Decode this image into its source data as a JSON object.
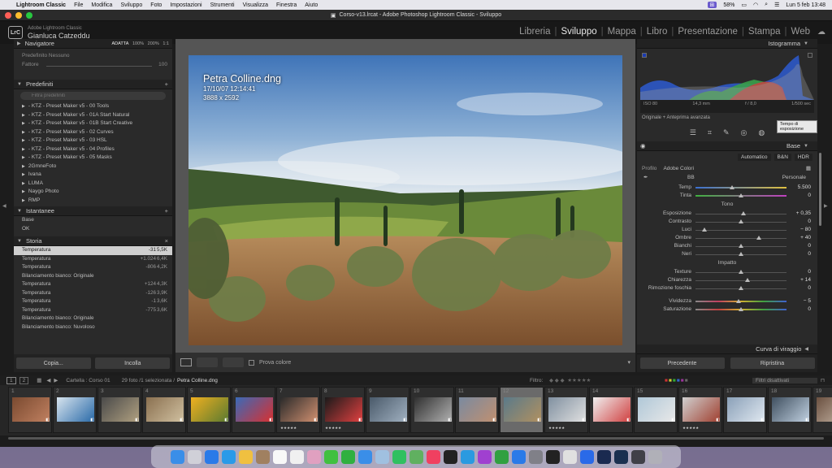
{
  "macos": {
    "menu": [
      "Lightroom Classic",
      "File",
      "Modifica",
      "Sviluppo",
      "Foto",
      "Impostazioni",
      "Strumenti",
      "Visualizza",
      "Finestra",
      "Aiuto"
    ],
    "battery": "58%",
    "clock": "Lun 5 feb  13:48"
  },
  "window": {
    "title": "Corso-v13.lrcat - Adobe Photoshop Lightroom Classic - Sviluppo"
  },
  "identity": {
    "badge": "LrC",
    "product": "Adobe Lightroom Classic",
    "user": "Gianluca Catzeddu"
  },
  "modules": [
    "Libreria",
    "Sviluppo",
    "Mappa",
    "Libro",
    "Presentazione",
    "Stampa",
    "Web"
  ],
  "left": {
    "navigator": {
      "title": "Navigatore",
      "zoom": [
        "ADATTA",
        "100%",
        "200%",
        "1:1"
      ]
    },
    "preset_preview": {
      "label": "Predefinito Nessuno",
      "amount_label": "Fattore",
      "amount": "100"
    },
    "presets": {
      "title": "Predefiniti",
      "search_placeholder": "Filtra predefiniti",
      "items": [
        "- KTZ - Preset Maker v5 - 00 Tools",
        "- KTZ - Preset Maker v5 - 01A Start Natural",
        "- KTZ - Preset Maker v5 - 01B Start Creative",
        "- KTZ - Preset Maker v5 - 02 Curves",
        "- KTZ - Preset Maker v5 - 03 HSL",
        "- KTZ - Preset Maker v5 - 04 Profiles",
        "- KTZ - Preset Maker v5 - 05 Masks",
        "2GmneFoto",
        "Ivana",
        "LUMA",
        "Naygo Photo",
        "RMP"
      ]
    },
    "snapshots": {
      "title": "Istantanee",
      "items": [
        "Base",
        "OK"
      ]
    },
    "history": {
      "title": "Storia",
      "items": [
        {
          "label": "Temperatura",
          "a": "-31",
          "b": "5,5K"
        },
        {
          "label": "Temperatura",
          "a": "+1.024",
          "b": "6,4K"
        },
        {
          "label": "Temperatura",
          "a": "-806",
          "b": "4,2K"
        },
        {
          "label": "Bilanciamento bianco: Originale",
          "a": "",
          "b": ""
        },
        {
          "label": "Temperatura",
          "a": "+124",
          "b": "4,3K"
        },
        {
          "label": "Temperatura",
          "a": "-126",
          "b": "3,9K"
        },
        {
          "label": "Temperatura",
          "a": "-1",
          "b": "3,6K"
        },
        {
          "label": "Temperatura",
          "a": "-775",
          "b": "3,6K"
        },
        {
          "label": "Bilanciamento bianco: Originale",
          "a": "",
          "b": ""
        },
        {
          "label": "Bilanciamento bianco: Nuvoloso",
          "a": "",
          "b": ""
        }
      ]
    },
    "buttons": {
      "copy": "Copia...",
      "paste": "Incolla"
    }
  },
  "photo": {
    "filename": "Petra Colline.dng",
    "datetime": "17/10/07 12:14:41",
    "dims": "3888 x 2592"
  },
  "toolbar": {
    "soft_proof": "Prova colore"
  },
  "right": {
    "histogram": {
      "title": "Istogramma",
      "iso": "ISO 80",
      "focal": "14,3 mm",
      "aperture": "f / 8,0",
      "shutter": "1/500 sec",
      "original_label": "Originale + Anteprima avanzata",
      "tooltip": "Tempo di esposizione"
    },
    "basic": {
      "title": "Base",
      "modes": [
        "Automatico",
        "B&N",
        "HDR"
      ],
      "profile_label": "Profilo",
      "profile_value": "Adobe Colori",
      "wb_label": "BB",
      "wb_value": "Personale",
      "temp": {
        "label": "Temp",
        "value": "5.500",
        "pos": 0.4
      },
      "tint": {
        "label": "Tinta",
        "value": "0",
        "pos": 0.5
      },
      "tone_title": "Tono",
      "tone": [
        {
          "label": "Esposizione",
          "value": "+ 0,35",
          "pos": 0.53
        },
        {
          "label": "Contrasto",
          "value": "0",
          "pos": 0.5
        },
        {
          "label": "Luci",
          "value": "− 80",
          "pos": 0.1
        },
        {
          "label": "Ombre",
          "value": "+ 40",
          "pos": 0.7
        },
        {
          "label": "Bianchi",
          "value": "0",
          "pos": 0.5
        },
        {
          "label": "Neri",
          "value": "0",
          "pos": 0.5
        }
      ],
      "presence_title": "Impatto",
      "presence": [
        {
          "label": "Texture",
          "value": "0",
          "pos": 0.5
        },
        {
          "label": "Chiarezza",
          "value": "+ 14",
          "pos": 0.57
        },
        {
          "label": "Rimozione foschia",
          "value": "0",
          "pos": 0.5
        },
        {
          "label": "Vividezza",
          "value": "− 5",
          "pos": 0.47
        },
        {
          "label": "Saturazione",
          "value": "0",
          "pos": 0.5
        }
      ],
      "next_title": "Curva di viraggio"
    },
    "buttons": {
      "previous": "Precedente",
      "reset": "Ripristina"
    }
  },
  "filmstrip": {
    "pages": [
      "1",
      "2"
    ],
    "source": "Cartella : Corso 01",
    "count": "29 foto /1 selezionata /",
    "selected": "Petra Colline.dng",
    "filter_label": "Filtro:",
    "filter_value": "Filtri disattivati",
    "numbers": [
      "1",
      "2",
      "3",
      "4",
      "5",
      "6",
      "7",
      "8",
      "9",
      "10",
      "11",
      "12",
      "13",
      "14",
      "15",
      "16",
      "17",
      "18",
      "19"
    ]
  }
}
